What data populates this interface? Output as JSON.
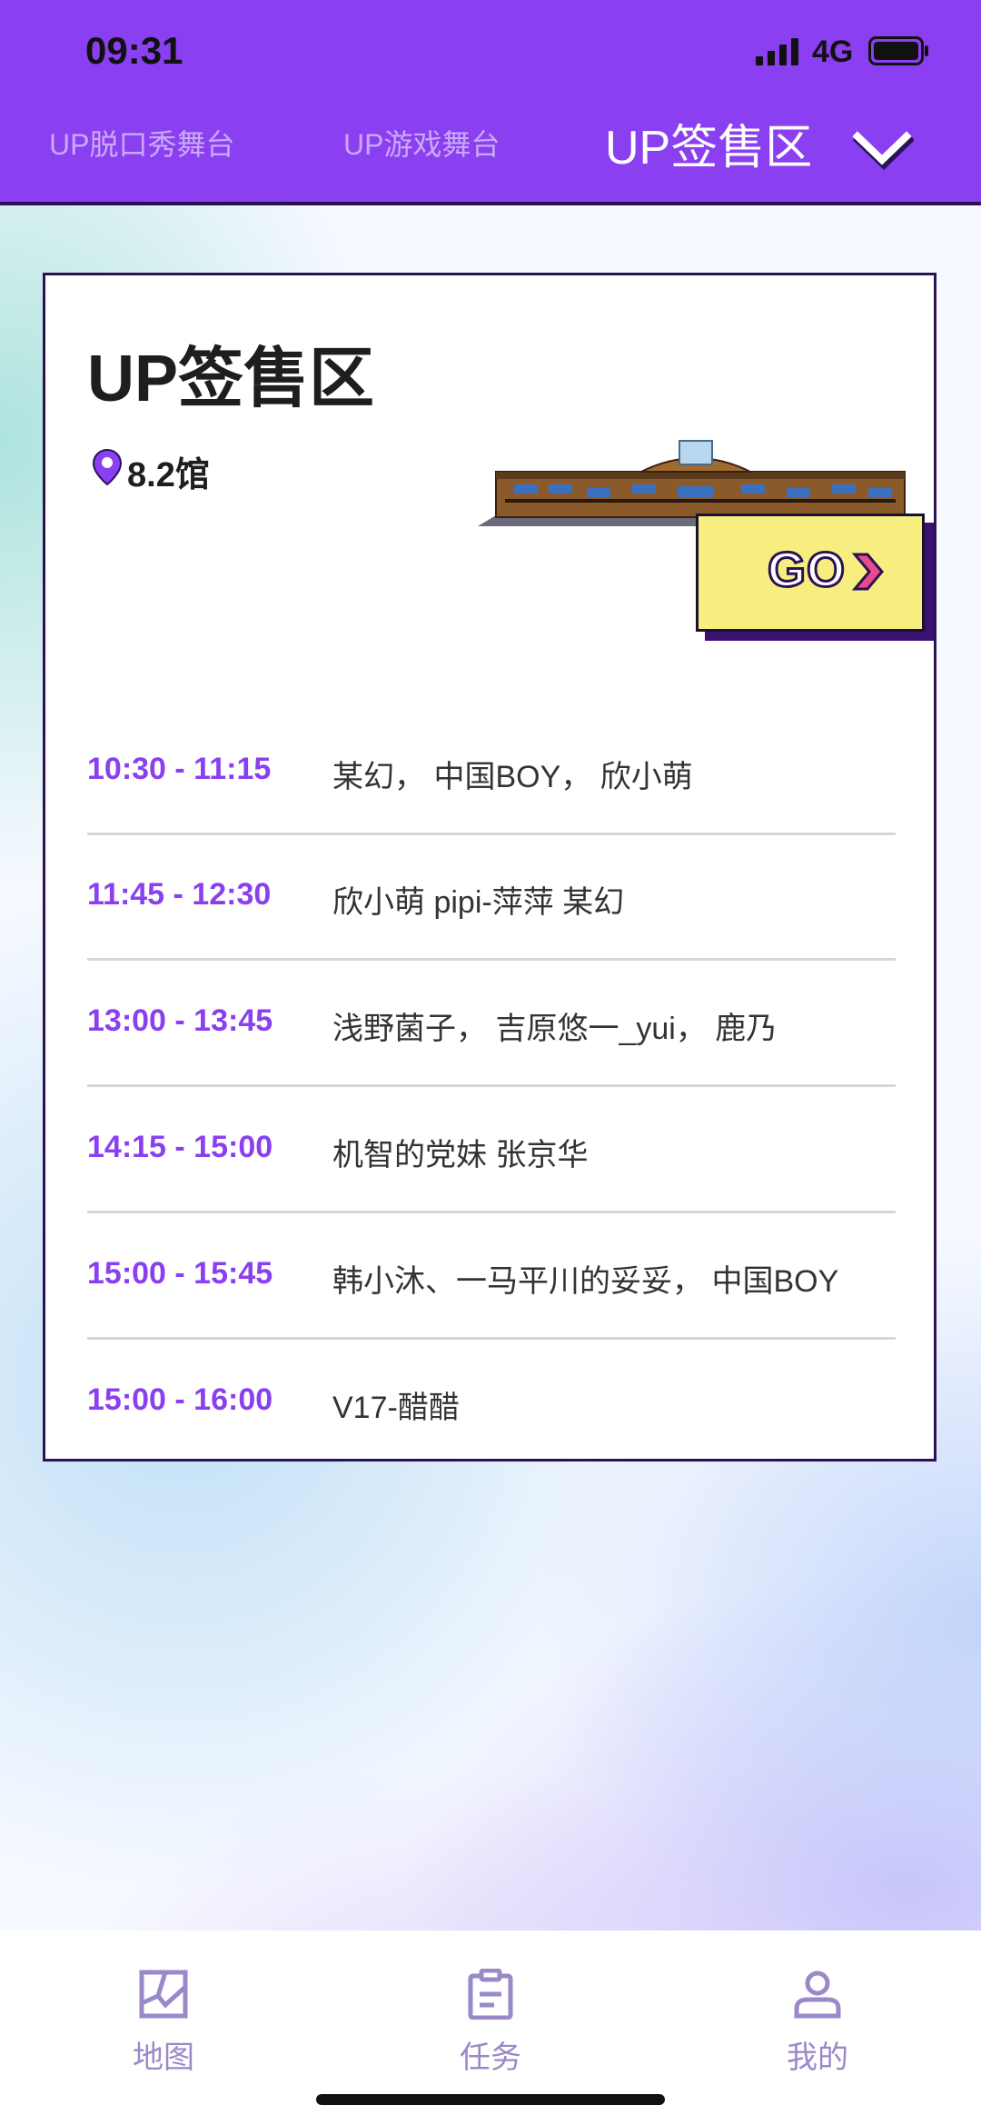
{
  "status_bar": {
    "time": "09:31",
    "network": "4G"
  },
  "header": {
    "tabs": [
      "UP脱口秀舞台",
      "UP游戏舞台",
      "UP签售区"
    ],
    "active_tab": "UP签售区"
  },
  "card": {
    "title": "UP签售区",
    "location": "8.2馆",
    "go_label": "GO",
    "schedule": [
      {
        "time": "10:30 - 11:15",
        "names": "某幻， 中国BOY， 欣小萌"
      },
      {
        "time": "11:45 - 12:30",
        "names": "欣小萌 pipi-萍萍 某幻"
      },
      {
        "time": "13:00 - 13:45",
        "names": "浅野菌子， 吉原悠一_yui， 鹿乃"
      },
      {
        "time": "14:15 - 15:00",
        "names": "机智的党妹 张京华"
      },
      {
        "time": "15:00 - 15:45",
        "names": "韩小沐、一马平川的妥妥， 中国BOY"
      },
      {
        "time": "15:00 - 16:00",
        "names": "V17-醋醋"
      }
    ]
  },
  "bottom_nav": {
    "items": [
      {
        "label": "地图",
        "icon": "map-icon"
      },
      {
        "label": "任务",
        "icon": "clipboard-icon"
      },
      {
        "label": "我的",
        "icon": "user-icon"
      }
    ]
  },
  "colors": {
    "header_bg": "#8a3ff0",
    "accent_time": "#8a3ff0",
    "go_button": "#f8ee80",
    "nav_icon": "#9a88c8"
  }
}
